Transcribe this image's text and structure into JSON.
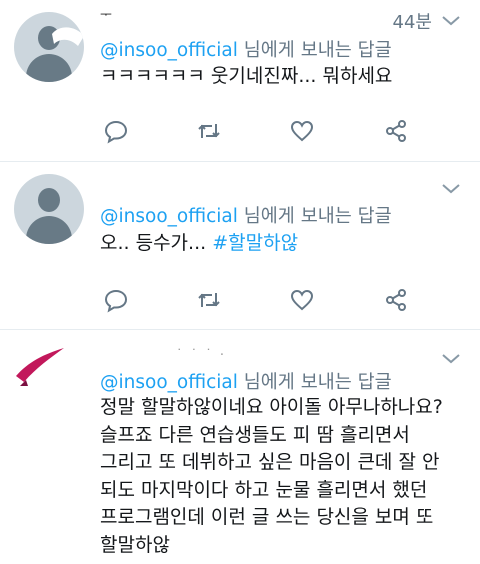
{
  "tweets": [
    {
      "name": "ᅮ",
      "time": "44분",
      "reply_handle": "@insoo_official",
      "reply_suffix": " 님에게 보내는 답글",
      "text_plain": "ㅋㅋㅋㅋㅋㅋ 웃기네진짜... 뭐하세요",
      "icons": [
        "reply-icon",
        "retweet-icon",
        "like-icon",
        "share-icon"
      ]
    },
    {
      "reply_handle": "@insoo_official",
      "reply_suffix": " 님에게 보내는 답글",
      "text_plain": "오.. 등수가... ",
      "hashtag": "#할말하않",
      "icons": [
        "reply-icon",
        "retweet-icon",
        "like-icon",
        "share-icon"
      ]
    },
    {
      "name": "˙ ˙ ˙ ·",
      "reply_handle": "@insoo_official",
      "reply_suffix": " 님에게 보내는 답글",
      "lines": [
        "정말 할말하않이네요 아이돌 아무나하나요?",
        "슬프죠 다른 연습생들도 피 땀 흘리면서",
        "그리고 또 데뷔하고 싶은 마음이 큰데 잘 안",
        "되도 마지막이다 하고 눈물 흘리면서 했던",
        "프로그램인데 이런 글 쓰는 당신을 보며 또",
        "할말하않"
      ]
    }
  ],
  "colors": {
    "link": "#1da1f2",
    "meta": "#657786",
    "icon": "#657786",
    "avatar_bg": "#ccd6dd",
    "avatar_fg": "#687a86",
    "divider": "#e6ecf0"
  }
}
